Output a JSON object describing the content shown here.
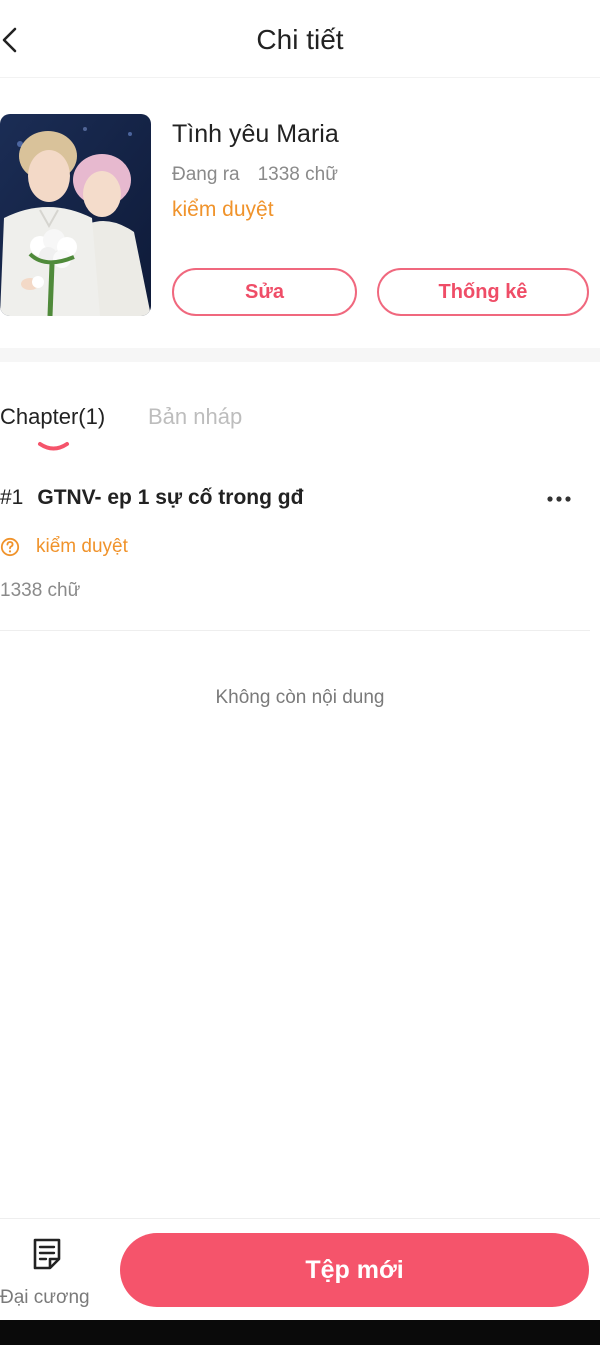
{
  "header": {
    "title": "Chi tiết"
  },
  "book": {
    "title": "Tình yêu Maria",
    "status_text": "Đang ra",
    "word_count": "1338 chữ",
    "review_status": "kiểm duyệt",
    "edit_label": "Sửa",
    "stats_label": "Thống kê"
  },
  "tabs": [
    {
      "label": "Chapter(1)",
      "active": true
    },
    {
      "label": "Bản nháp",
      "active": false
    }
  ],
  "chapters": [
    {
      "number": "#1",
      "title": "GTNV- ep 1 sự cố trong gđ",
      "status": "kiểm duyệt",
      "word_count": "1338 chữ"
    }
  ],
  "empty_message": "Không còn nội dung",
  "bottom": {
    "outline_label": "Đại cương",
    "new_label": "Tệp mới"
  },
  "colors": {
    "accent": "#f5546b",
    "pending": "#f0932b"
  }
}
